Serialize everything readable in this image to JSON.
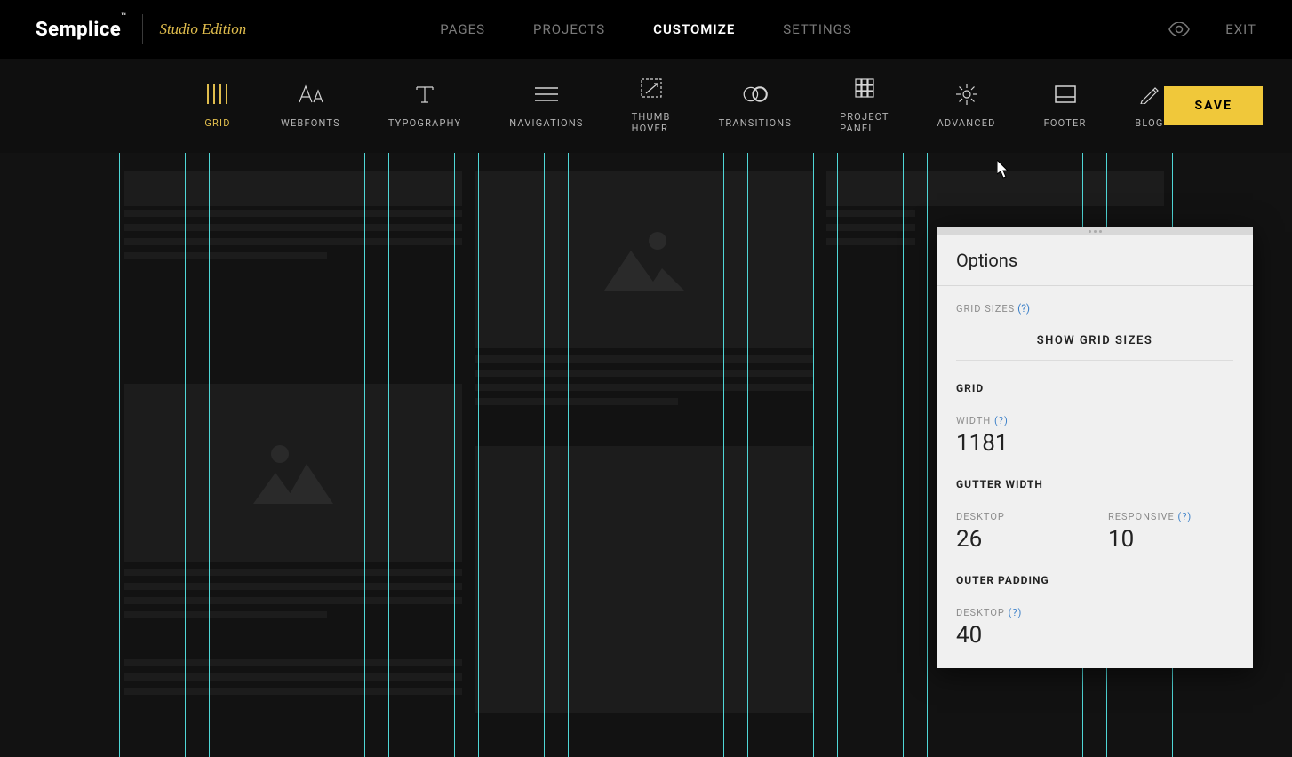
{
  "header": {
    "logo": "Semplice",
    "logo_tm": "™",
    "edition": "Studio Edition",
    "nav": [
      "PAGES",
      "PROJECTS",
      "CUSTOMIZE",
      "SETTINGS"
    ],
    "nav_active_index": 2,
    "exit": "EXIT"
  },
  "subnav": {
    "items": [
      {
        "label": "GRID",
        "icon": "grid-columns-icon",
        "active": true
      },
      {
        "label": "WEBFONTS",
        "icon": "webfonts-icon"
      },
      {
        "label": "TYPOGRAPHY",
        "icon": "typography-icon"
      },
      {
        "label": "NAVIGATIONS",
        "icon": "navigations-icon"
      },
      {
        "label": "THUMB HOVER",
        "icon": "thumb-hover-icon"
      },
      {
        "label": "TRANSITIONS",
        "icon": "transitions-icon"
      },
      {
        "label": "PROJECT PANEL",
        "icon": "project-panel-icon"
      },
      {
        "label": "ADVANCED",
        "icon": "advanced-icon"
      },
      {
        "label": "FOOTER",
        "icon": "footer-icon"
      },
      {
        "label": "BLOG",
        "icon": "blog-icon"
      }
    ],
    "save": "SAVE"
  },
  "panel": {
    "title": "Options",
    "grid_sizes_label": "GRID SIZES",
    "help": "(?)",
    "show_grid_sizes": "SHOW GRID SIZES",
    "grid_head": "GRID",
    "width_label": "WIDTH",
    "width_value": "1181",
    "gutter_head": "GUTTER WIDTH",
    "desktop_label": "DESKTOP",
    "gutter_desktop": "26",
    "responsive_label": "RESPONSIVE",
    "gutter_responsive": "10",
    "outer_padding_head": "OUTER PADDING",
    "outer_desktop_label": "DESKTOP",
    "outer_desktop": "40"
  },
  "grid": {
    "columns": 12
  }
}
